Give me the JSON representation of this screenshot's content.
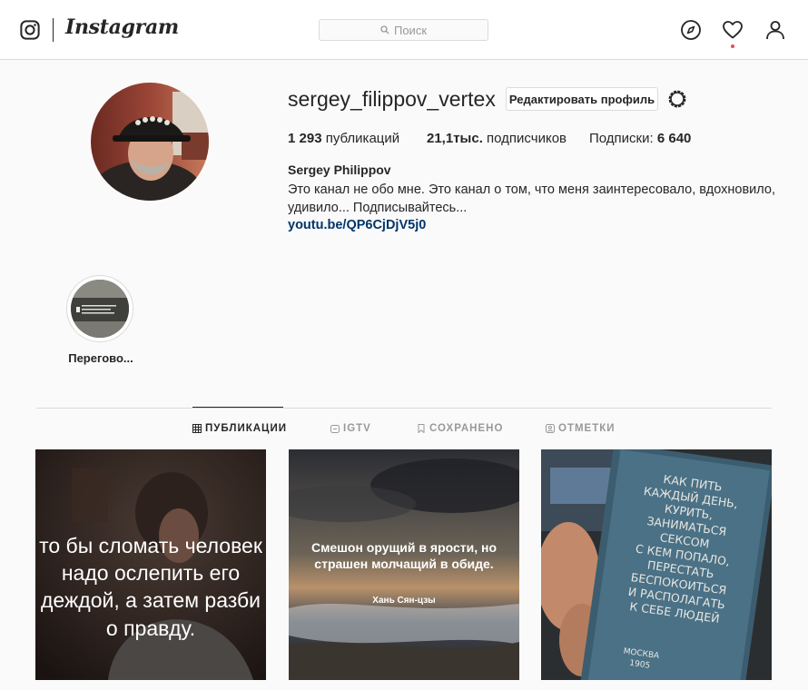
{
  "header": {
    "brand": "Instagram",
    "search_placeholder": "Поиск",
    "icons": [
      "instagram-logo-icon",
      "search-icon",
      "compass-icon",
      "heart-icon",
      "user-icon"
    ]
  },
  "profile": {
    "username": "sergey_filippov_vertex",
    "edit_button": "Редактировать профиль",
    "stats": {
      "posts_count": "1 293",
      "posts_label": "публикаций",
      "followers_count": "21,1тыс.",
      "followers_label": "подписчиков",
      "following_label": "Подписки:",
      "following_count": "6 640"
    },
    "full_name": "Sergey Philippov",
    "bio": "Это канал не обо мне. Это канал о том, что меня заинтересовало, вдохновило, удивило... Подписывайтесь...",
    "link": "youtu.be/QP6CjDjV5j0"
  },
  "highlights": [
    {
      "label": "Перегово..."
    }
  ],
  "tabs": [
    {
      "label": "ПУБЛИКАЦИИ",
      "icon": "grid-icon",
      "active": true
    },
    {
      "label": "IGTV",
      "icon": "igtv-icon",
      "active": false
    },
    {
      "label": "СОХРАНЕНО",
      "icon": "bookmark-icon",
      "active": false
    },
    {
      "label": "ОТМЕТКИ",
      "icon": "tag-person-icon",
      "active": false
    }
  ],
  "posts": [
    {
      "lines": [
        "то бы сломать человек",
        "надо ослепить его",
        "деждой, а затем разби",
        "о правду."
      ]
    },
    {
      "quote_lines": [
        "Смешон орущий в ярости, но",
        "страшен молчащий в обиде."
      ],
      "author": "Хань Сян-цзы"
    },
    {
      "book_lines": [
        "КАК ПИТЬ",
        "КАЖДЫЙ ДЕНЬ,",
        "КУРИТЬ,",
        "ЗАНИМАТЬСЯ",
        "СЕКСОМ",
        "С КЕМ ПОПАЛО,",
        "ПЕРЕСТАТЬ",
        "БЕСПОКОИТЬСЯ",
        "И РАСПОЛАГАТЬ",
        "К СЕБЕ ЛЮДЕЙ"
      ],
      "book_footer": [
        "МОСКВА",
        "1905"
      ]
    }
  ],
  "colors": {
    "background": "#fafafa",
    "text": "#262626",
    "muted": "#999999",
    "border": "#dbdbdb",
    "link": "#003569",
    "notification": "#ed4956"
  }
}
